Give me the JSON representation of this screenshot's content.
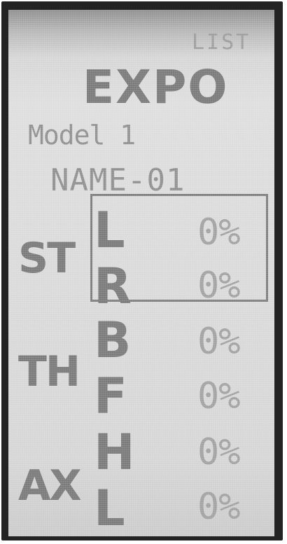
{
  "screen": {
    "list_label": "LIST",
    "title": "EXPO",
    "model_label": "Model 1",
    "model_name": "NAME-01"
  },
  "groups": [
    {
      "label": "ST",
      "channels": [
        {
          "letter": "L",
          "value": "0%"
        },
        {
          "letter": "R",
          "value": "0%"
        }
      ]
    },
    {
      "label": "TH",
      "channels": [
        {
          "letter": "B",
          "value": "0%"
        },
        {
          "letter": "F",
          "value": "0%"
        }
      ]
    },
    {
      "label": "AX",
      "channels": [
        {
          "letter": "H",
          "value": "0%"
        },
        {
          "letter": "L",
          "value": "0%"
        }
      ]
    }
  ],
  "selected_group": "ST",
  "colors": {
    "bezel": "#232323",
    "lcd_background": "#dadada",
    "segment_dark": "#7a7a7a",
    "segment_light": "#a2a2a2"
  }
}
